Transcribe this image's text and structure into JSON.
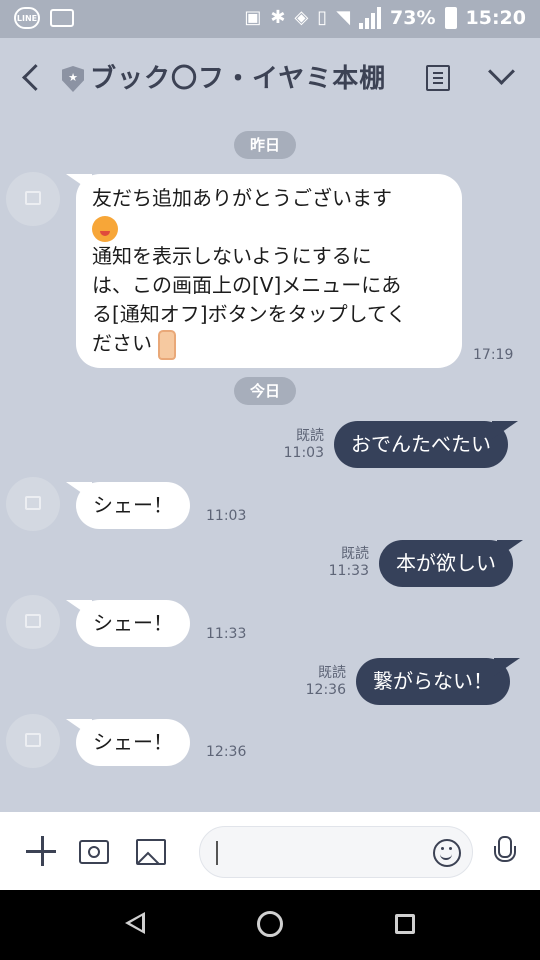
{
  "status_bar": {
    "app_badge": "LINE",
    "battery": "73%",
    "time": "15:20"
  },
  "header": {
    "title": "ブック〇フ・イヤミ本棚"
  },
  "chat": {
    "date_yesterday": "昨日",
    "date_today": "今日",
    "messages": [
      {
        "direction": "in",
        "lines": [
          "友だち追加ありがとうございます",
          "通知を表示しないようにするに",
          "は、この画面上の[V]メニューにあ",
          "る[通知オフ]ボタンをタップしてく",
          "ださい"
        ],
        "time": "17:19"
      },
      {
        "direction": "out",
        "text": "おでんたべたい",
        "read": "既読",
        "time": "11:03"
      },
      {
        "direction": "in",
        "text": "シェー！",
        "time": "11:03"
      },
      {
        "direction": "out",
        "text": "本が欲しい",
        "read": "既読",
        "time": "11:33"
      },
      {
        "direction": "in",
        "text": "シェー！",
        "time": "11:33"
      },
      {
        "direction": "out",
        "text": "繋がらない！",
        "read": "既読",
        "time": "12:36"
      },
      {
        "direction": "in",
        "text": "シェー！",
        "time": "12:36"
      }
    ]
  },
  "input_bar": {
    "message_value": ""
  }
}
